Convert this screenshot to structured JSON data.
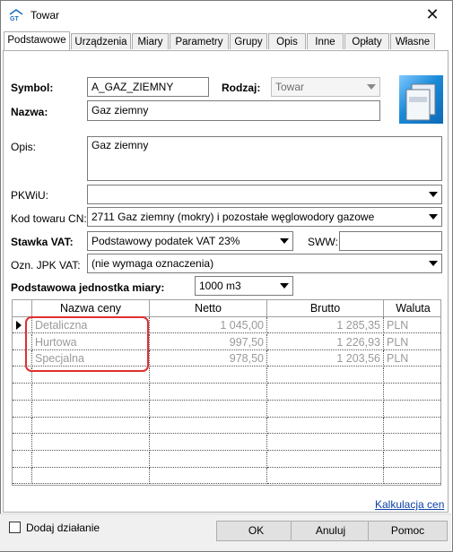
{
  "window": {
    "title": "Towar",
    "close_glyph": "✕"
  },
  "tabs": [
    "Podstawowe",
    "Urządzenia",
    "Miary",
    "Parametry",
    "Grupy",
    "Opis",
    "Inne",
    "Opłaty",
    "Własne"
  ],
  "form": {
    "symbol_label": "Symbol:",
    "symbol_value": "A_GAZ_ZIEMNY",
    "rodzaj_label": "Rodzaj:",
    "rodzaj_value": "Towar",
    "nazwa_label": "Nazwa:",
    "nazwa_value": "Gaz ziemny",
    "opis_label": "Opis:",
    "opis_value": "Gaz ziemny",
    "pkwiu_label": "PKWiU:",
    "pkwiu_value": "",
    "kod_cn_label": "Kod towaru CN:",
    "kod_cn_value": "2711 Gaz ziemny (mokry) i pozostałe węglowodory gazowe",
    "vat_label": "Stawka VAT:",
    "vat_value": "Podstawowy podatek VAT 23%",
    "sww_label": "SWW:",
    "sww_value": "",
    "jpk_label": "Ozn. JPK VAT:",
    "jpk_value": "(nie wymaga oznaczenia)",
    "unit_label": "Podstawowa jednostka miary:",
    "unit_value": "1000 m3"
  },
  "grid": {
    "columns": [
      "Nazwa ceny",
      "Netto",
      "Brutto",
      "Waluta"
    ],
    "rows": [
      {
        "name": "Detaliczna",
        "netto": "1 045,00",
        "brutto": "1 285,35",
        "waluta": "PLN"
      },
      {
        "name": "Hurtowa",
        "netto": "997,50",
        "brutto": "1 226,93",
        "waluta": "PLN"
      },
      {
        "name": "Specjalna",
        "netto": "978,50",
        "brutto": "1 203,56",
        "waluta": "PLN"
      }
    ]
  },
  "link_kalkulacja": "Kalkulacja cen",
  "footer": {
    "checkbox_label": "Dodaj działanie",
    "ok": "OK",
    "cancel": "Anuluj",
    "help": "Pomoc"
  },
  "colors": {
    "highlight_box": "#e03030",
    "link": "#0b3fa7",
    "grey_text": "#9a9a9a"
  }
}
